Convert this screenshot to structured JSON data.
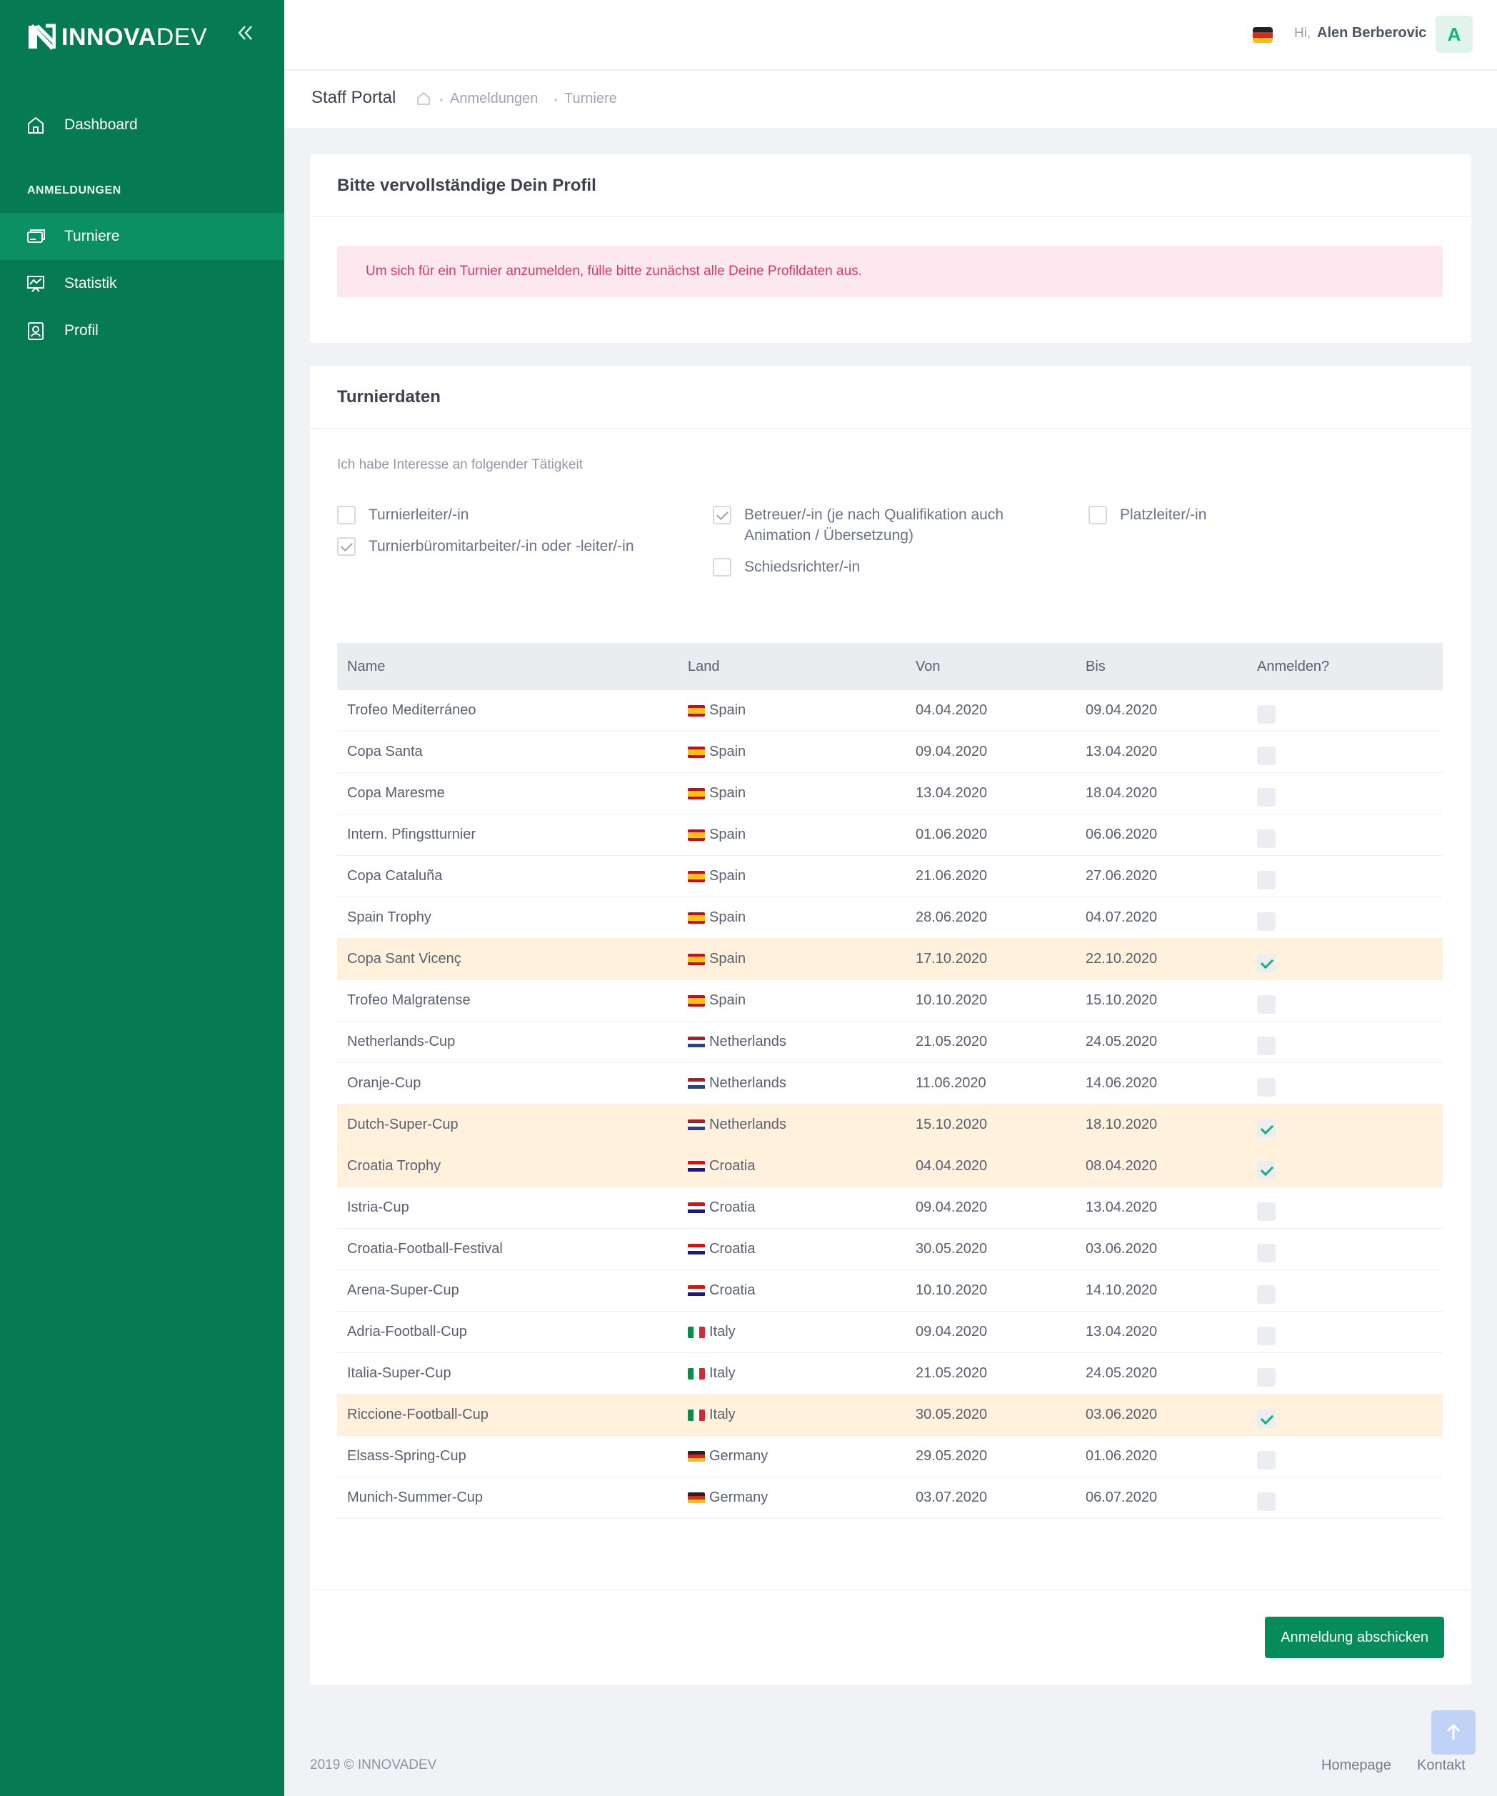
{
  "brand": {
    "name_bold": "INNOVA",
    "name_light": "DEV"
  },
  "sidebar": {
    "dashboard": "Dashboard",
    "section": "ANMELDUNGEN",
    "items": [
      {
        "label": "Turniere",
        "icon": "tournament-icon",
        "active": true
      },
      {
        "label": "Statistik",
        "icon": "statistics-icon",
        "active": false
      },
      {
        "label": "Profil",
        "icon": "profile-icon",
        "active": false
      }
    ]
  },
  "header": {
    "greeting": "Hi,",
    "user": "Alen Berberovic",
    "avatar_letter": "A",
    "language": "German"
  },
  "subheader": {
    "title": "Staff Portal",
    "breadcrumb": [
      "Anmeldungen",
      "Turniere"
    ]
  },
  "profile_card": {
    "title": "Bitte vervollständige Dein Profil",
    "alert": "Um sich für ein Turnier anzumelden, fülle bitte zunächst alle Deine Profildaten aus."
  },
  "tournament_card": {
    "title": "Turnierdaten",
    "interest_label": "Ich habe Interesse an folgender Tätigkeit",
    "roles": [
      {
        "label": "Turnierleiter/-in",
        "checked": false
      },
      {
        "label": "Turnierbüromitarbeiter/-in oder -leiter/-in",
        "checked": true
      },
      {
        "label_line1": "Betreuer/-in (je nach Qualifikation auch",
        "label_line2": "Animation / Übersetzung)",
        "checked": true
      },
      {
        "label": "Schiedsrichter/-in",
        "checked": false
      },
      {
        "label": "Platzleiter/-in",
        "checked": false
      }
    ],
    "columns": [
      "Name",
      "Land",
      "Von",
      "Bis",
      "Anmelden?"
    ],
    "rows": [
      {
        "name": "Trofeo Mediterráneo",
        "country": "Spain",
        "from": "04.04.2020",
        "to": "09.04.2020",
        "checked": false
      },
      {
        "name": "Copa Santa",
        "country": "Spain",
        "from": "09.04.2020",
        "to": "13.04.2020",
        "checked": false
      },
      {
        "name": "Copa Maresme",
        "country": "Spain",
        "from": "13.04.2020",
        "to": "18.04.2020",
        "checked": false
      },
      {
        "name": "Intern. Pfingstturnier",
        "country": "Spain",
        "from": "01.06.2020",
        "to": "06.06.2020",
        "checked": false
      },
      {
        "name": "Copa Cataluña",
        "country": "Spain",
        "from": "21.06.2020",
        "to": "27.06.2020",
        "checked": false
      },
      {
        "name": "Spain Trophy",
        "country": "Spain",
        "from": "28.06.2020",
        "to": "04.07.2020",
        "checked": false
      },
      {
        "name": "Copa Sant Vicenç",
        "country": "Spain",
        "from": "17.10.2020",
        "to": "22.10.2020",
        "checked": true
      },
      {
        "name": "Trofeo Malgratense",
        "country": "Spain",
        "from": "10.10.2020",
        "to": "15.10.2020",
        "checked": false
      },
      {
        "name": "Netherlands-Cup",
        "country": "Netherlands",
        "from": "21.05.2020",
        "to": "24.05.2020",
        "checked": false
      },
      {
        "name": "Oranje-Cup",
        "country": "Netherlands",
        "from": "11.06.2020",
        "to": "14.06.2020",
        "checked": false
      },
      {
        "name": "Dutch-Super-Cup",
        "country": "Netherlands",
        "from": "15.10.2020",
        "to": "18.10.2020",
        "checked": true
      },
      {
        "name": "Croatia Trophy",
        "country": "Croatia",
        "from": "04.04.2020",
        "to": "08.04.2020",
        "checked": true
      },
      {
        "name": "Istria-Cup",
        "country": "Croatia",
        "from": "09.04.2020",
        "to": "13.04.2020",
        "checked": false
      },
      {
        "name": "Croatia-Football-Festival",
        "country": "Croatia",
        "from": "30.05.2020",
        "to": "03.06.2020",
        "checked": false
      },
      {
        "name": "Arena-Super-Cup",
        "country": "Croatia",
        "from": "10.10.2020",
        "to": "14.10.2020",
        "checked": false
      },
      {
        "name": "Adria-Football-Cup",
        "country": "Italy",
        "from": "09.04.2020",
        "to": "13.04.2020",
        "checked": false
      },
      {
        "name": "Italia-Super-Cup",
        "country": "Italy",
        "from": "21.05.2020",
        "to": "24.05.2020",
        "checked": false
      },
      {
        "name": "Riccione-Football-Cup",
        "country": "Italy",
        "from": "30.05.2020",
        "to": "03.06.2020",
        "checked": true
      },
      {
        "name": "Elsass-Spring-Cup",
        "country": "Germany",
        "from": "29.05.2020",
        "to": "01.06.2020",
        "checked": false
      },
      {
        "name": "Munich-Summer-Cup",
        "country": "Germany",
        "from": "03.07.2020",
        "to": "06.07.2020",
        "checked": false
      }
    ],
    "submit": "Anmeldung abschicken"
  },
  "footer": {
    "copyright": "2019 © INNOVADEV",
    "links": [
      "Homepage",
      "Kontakt"
    ]
  },
  "colors": {
    "sidebar": "#067a52",
    "sidebar_active": "#0a9062",
    "accent": "#068b5b",
    "alert_bg": "#fde8ef",
    "alert_text": "#e0326f",
    "selected_row": "#fff1dc"
  }
}
